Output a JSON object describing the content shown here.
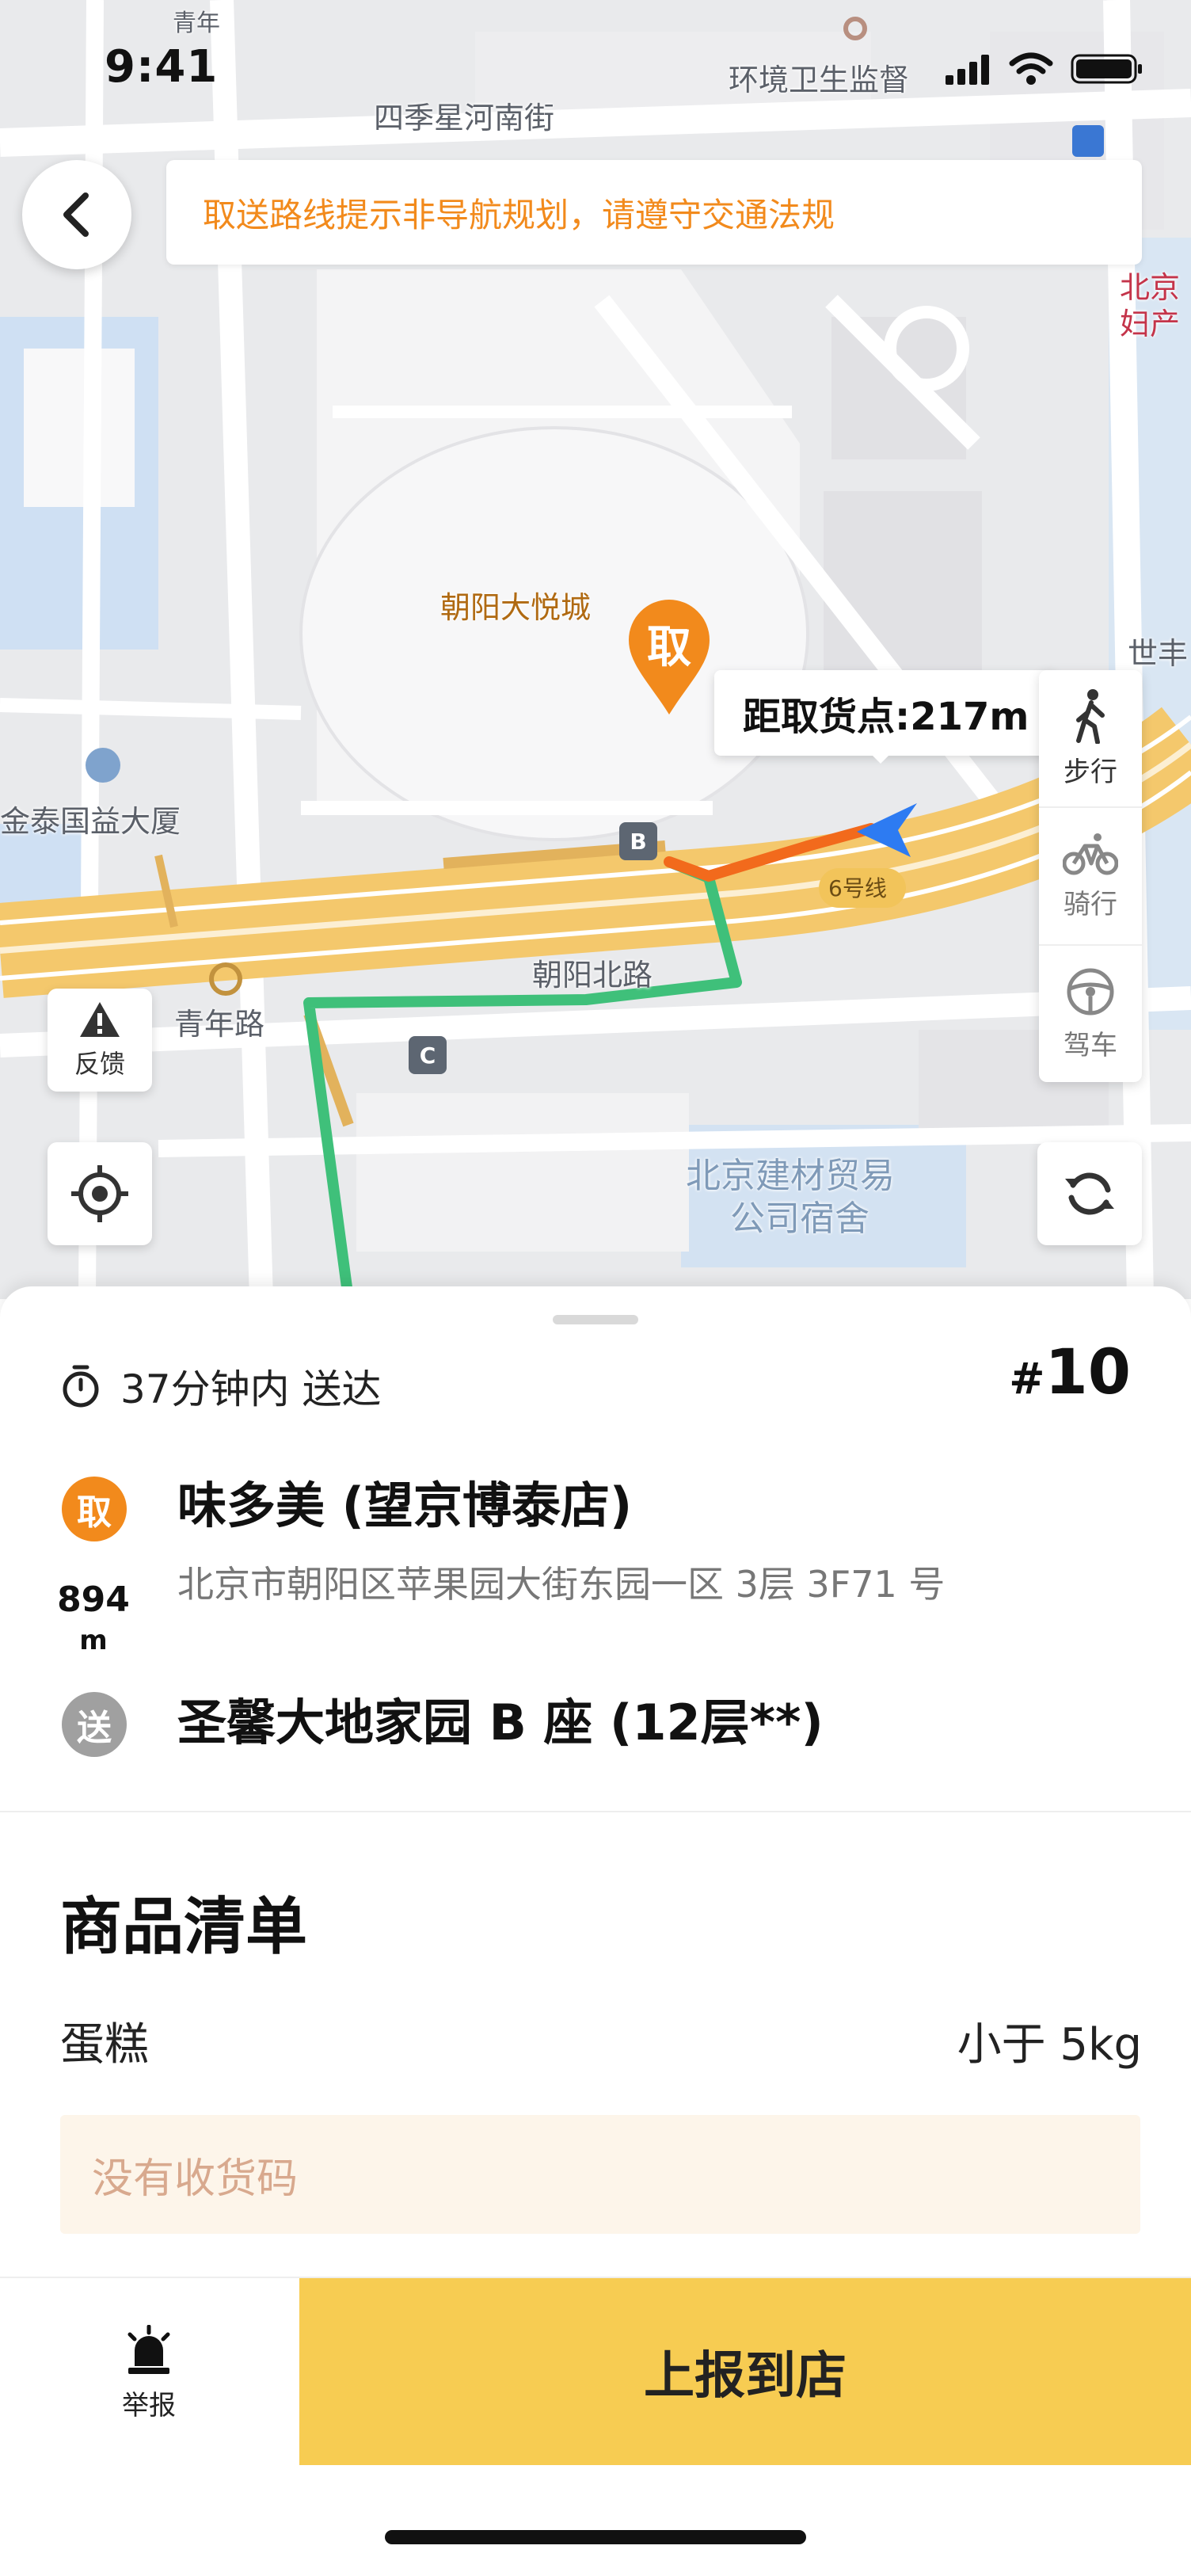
{
  "status_bar": {
    "time": "9:41"
  },
  "notice": {
    "text": "取送路线提示非导航规划，请遵守交通法规"
  },
  "map": {
    "labels": {
      "street_top": "四季星河南街",
      "env_office": "环境卫生监督",
      "mall": "朝阳大悦城",
      "building_left": "金泰国益大厦",
      "road_north": "朝阳北路",
      "road_qingnian": "青年路",
      "metro_line": "6号线",
      "hospital_1": "北京",
      "hospital_2": "妇产",
      "edge_right": "世丰",
      "edge_top_left": "青年",
      "dorm_1": "北京建材贸易",
      "dorm_2": "公司宿舍"
    },
    "pickup_marker": "取",
    "distance_tip": "距取货点:217m",
    "exit_b": "B",
    "exit_c": "C",
    "modes": [
      {
        "label": "步行",
        "icon": "walk-icon"
      },
      {
        "label": "骑行",
        "icon": "bike-icon"
      },
      {
        "label": "驾车",
        "icon": "steering-wheel-icon"
      }
    ],
    "feedback_label": "反馈"
  },
  "order": {
    "eta": "37分钟内 送达",
    "number_hash": "#",
    "number": "10",
    "pickup": {
      "badge": "取",
      "name": "味多美 (望京博泰店)",
      "address": "北京市朝阳区苹果园大街东园一区 3层 3F71 号"
    },
    "distance_value": "894",
    "distance_unit": "m",
    "delivery": {
      "badge": "送",
      "name": "圣馨大地家园 B 座 (12层**)"
    }
  },
  "goods": {
    "title": "商品清单",
    "items": [
      {
        "name": "蛋糕",
        "weight": "小于 5kg"
      }
    ],
    "no_code": "没有收货码"
  },
  "actions": {
    "report": "举报",
    "arrive": "上报到店"
  },
  "colors": {
    "accent_orange": "#f28a1c",
    "route_green": "#3fc07a",
    "button_yellow": "#f7cc52"
  }
}
